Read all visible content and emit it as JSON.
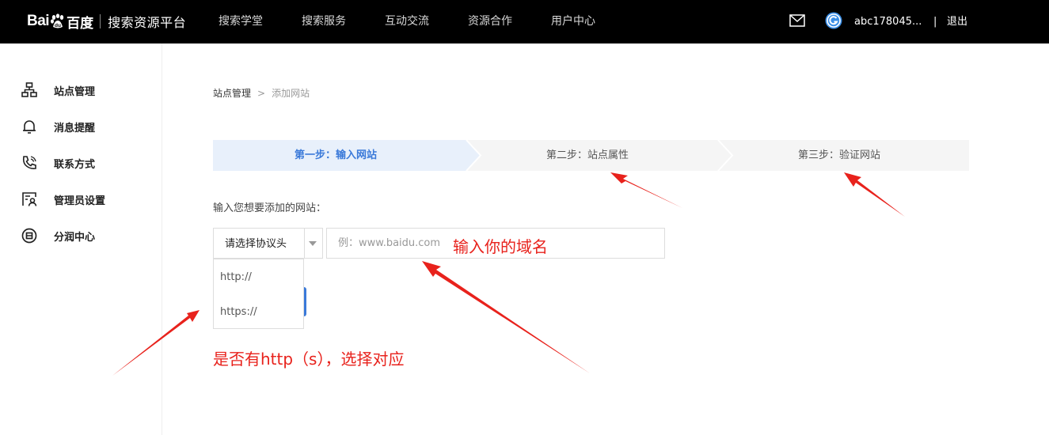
{
  "header": {
    "logo": {
      "bai": "Bai",
      "du": "百度",
      "title": "搜索资源平台"
    },
    "nav": [
      "搜索学堂",
      "搜索服务",
      "互动交流",
      "资源合作",
      "用户中心"
    ],
    "username": "abc178045...",
    "separator": "|",
    "logout": "退出"
  },
  "sidebar": {
    "items": [
      {
        "label": "站点管理",
        "icon": "sitemap-icon"
      },
      {
        "label": "消息提醒",
        "icon": "bell-icon"
      },
      {
        "label": "联系方式",
        "icon": "phone-icon"
      },
      {
        "label": "管理员设置",
        "icon": "admin-icon"
      },
      {
        "label": "分润中心",
        "icon": "revenue-icon"
      }
    ]
  },
  "breadcrumb": {
    "parent": "站点管理",
    "separator": ">",
    "current": "添加网站"
  },
  "steps": [
    {
      "label": "第一步：输入网站",
      "active": true
    },
    {
      "label": "第二步：站点属性",
      "active": false
    },
    {
      "label": "第三步：验证网站",
      "active": false
    }
  ],
  "form": {
    "label": "输入您想要添加的网站：",
    "protocol_select": {
      "value": "请选择协议头",
      "options": [
        "http://",
        "https://"
      ]
    },
    "domain_input": {
      "placeholder": "例：www.baidu.com",
      "value": ""
    }
  },
  "annotations": {
    "domain_hint": "输入你的域名",
    "protocol_hint": "是否有http（s），选择对应"
  },
  "colors": {
    "accent": "#3a79d9",
    "annotation": "#e8221c",
    "topbar": "#000000",
    "active_step_bg": "#e8f0fb"
  }
}
